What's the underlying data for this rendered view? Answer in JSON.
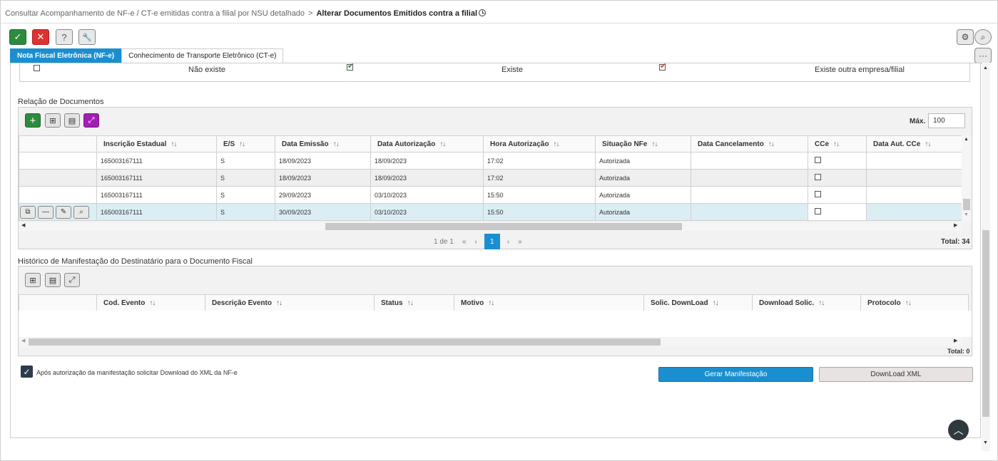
{
  "breadcrumb": {
    "parent": "Consultar Acompanhamento de NF-e / CT-e emitidas contra a filial por NSU detalhado",
    "separator": ">",
    "current": "Alterar Documentos Emitidos contra a filial"
  },
  "toolbar": {
    "confirm_icon": "✓",
    "cancel_icon": "✕",
    "help_icon": "?",
    "tool_icon": "🔧"
  },
  "right_toolbar": {
    "settings_icon": "⚙",
    "search_icon": "⌕",
    "more_icon": "···"
  },
  "tabs": [
    {
      "label": "Nota Fiscal Eletrônica (NF-e)",
      "active": true
    },
    {
      "label": "Conhecimento de Transporte Eletrônico (CT-e)",
      "active": false
    }
  ],
  "legend": {
    "not_exists": "Não existe",
    "exists": "Existe",
    "other_company": "Existe outra empresa/filial"
  },
  "documents": {
    "title": "Relação de Documentos",
    "max_label": "Máx.",
    "max_value": "100",
    "columns": [
      "Inscrição Estadual",
      "E/S",
      "Data Emissão",
      "Data Autorização",
      "Hora Autorização",
      "Situação NFe",
      "Data Cancelamento",
      "CCe",
      "Data Aut. CCe"
    ],
    "rows": [
      {
        "ie": "165003167111",
        "es": "S",
        "emissao": "18/09/2023",
        "autorizacao": "18/09/2023",
        "hora": "17:02",
        "situacao": "Autorizada",
        "cancelamento": "",
        "aut_cce": ""
      },
      {
        "ie": "165003167111",
        "es": "S",
        "emissao": "18/09/2023",
        "autorizacao": "18/09/2023",
        "hora": "17:02",
        "situacao": "Autorizada",
        "cancelamento": "",
        "aut_cce": ""
      },
      {
        "ie": "165003167111",
        "es": "S",
        "emissao": "29/09/2023",
        "autorizacao": "03/10/2023",
        "hora": "15:50",
        "situacao": "Autorizada",
        "cancelamento": "",
        "aut_cce": ""
      },
      {
        "ie": "165003167111",
        "es": "S",
        "emissao": "30/09/2023",
        "autorizacao": "03/10/2023",
        "hora": "15:50",
        "situacao": "Autorizada",
        "cancelamento": "",
        "aut_cce": ""
      }
    ],
    "pager": {
      "info": "1 de 1",
      "first": "«",
      "prev": "‹",
      "page": "1",
      "next": "›",
      "last": "»"
    },
    "total": "Total: 34"
  },
  "history": {
    "title": "Histórico de Manifestação do Destinatário para o Documento Fiscal",
    "columns": [
      "Cod. Evento",
      "Descrição Evento",
      "Status",
      "Motivo",
      "Solic. DownLoad",
      "Download Solic.",
      "Protocolo"
    ],
    "total": "Total: 0"
  },
  "footer": {
    "checkbox_label": "Após autorização da manifestação solicitar Download do XML da NF-e",
    "generate_button": "Gerar Manifestação",
    "download_button": "DownLoad XML"
  }
}
